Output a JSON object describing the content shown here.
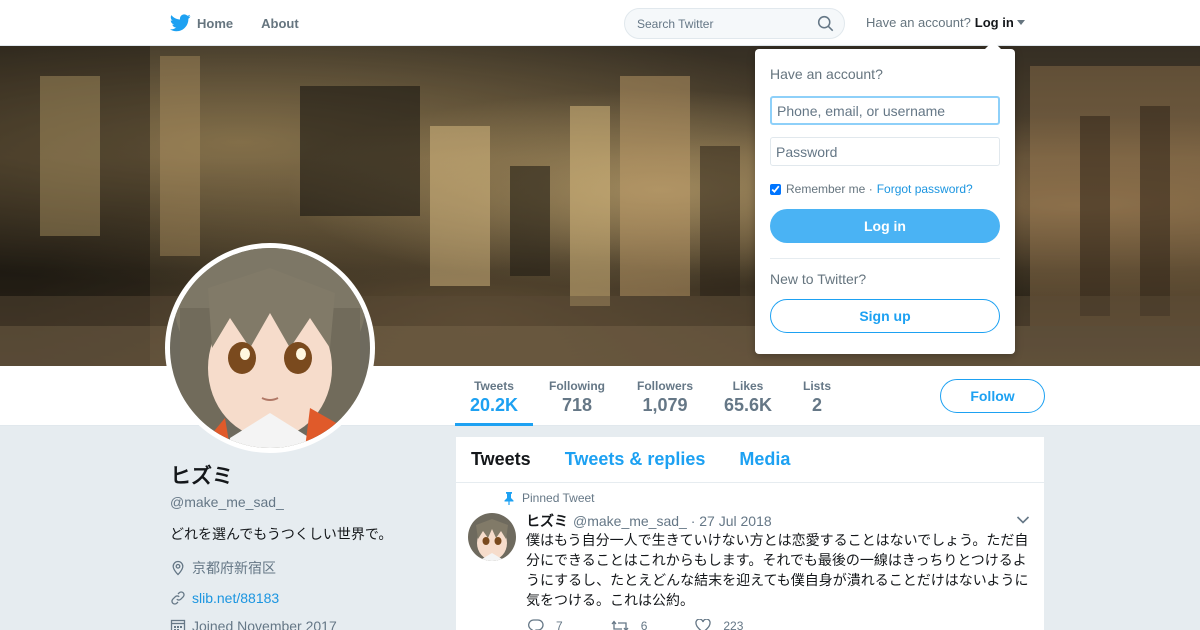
{
  "nav": {
    "home_label": "Home",
    "about_label": "About",
    "search_placeholder": "Search Twitter",
    "account_prompt": "Have an account?",
    "login_label": "Log in",
    "brand_color": "#1da1f2"
  },
  "profile": {
    "name": "ヒズミ",
    "handle": "@make_me_sad_",
    "bio": "どれを選んでもうつくしい世界で。",
    "location": "京都府新宿区",
    "website": "slib.net/88183",
    "joined": "Joined November 2017",
    "follow_label": "Follow"
  },
  "stats": [
    {
      "label": "Tweets",
      "value": "20.2K",
      "active": true
    },
    {
      "label": "Following",
      "value": "718",
      "active": false
    },
    {
      "label": "Followers",
      "value": "1,079",
      "active": false
    },
    {
      "label": "Likes",
      "value": "65.6K",
      "active": false
    },
    {
      "label": "Lists",
      "value": "2",
      "active": false
    }
  ],
  "timeline": {
    "tabs": [
      {
        "label": "Tweets",
        "active": true
      },
      {
        "label": "Tweets & replies",
        "active": false
      },
      {
        "label": "Media",
        "active": false
      }
    ],
    "tweet": {
      "pinned_label": "Pinned Tweet",
      "author": "ヒズミ",
      "handle_date": "@make_me_sad_ · 27 Jul 2018",
      "text": "僕はもう自分一人で生きていけない方とは恋愛することはないでしょう。ただ自分にできることはこれからもします。それでも最後の一線はきっちりとつけるようにするし、たとえどんな結末を迎えても僕自身が潰れることだけはないように気をつける。これは公約。",
      "replies": "7",
      "retweets": "6",
      "likes": "223"
    }
  },
  "login": {
    "title": "Have an account?",
    "username_placeholder": "Phone, email, or username",
    "password_placeholder": "Password",
    "remember_label": "Remember me ·",
    "forgot_label": "Forgot password?",
    "login_button": "Log in",
    "new_prompt": "New to Twitter?",
    "signup_button": "Sign up"
  },
  "icons": [
    "twitter-bird-icon",
    "home-icon",
    "search-icon",
    "location-icon",
    "link-icon",
    "calendar-icon",
    "pin-icon",
    "reply-icon",
    "retweet-icon",
    "like-icon",
    "chevron-down-icon"
  ]
}
